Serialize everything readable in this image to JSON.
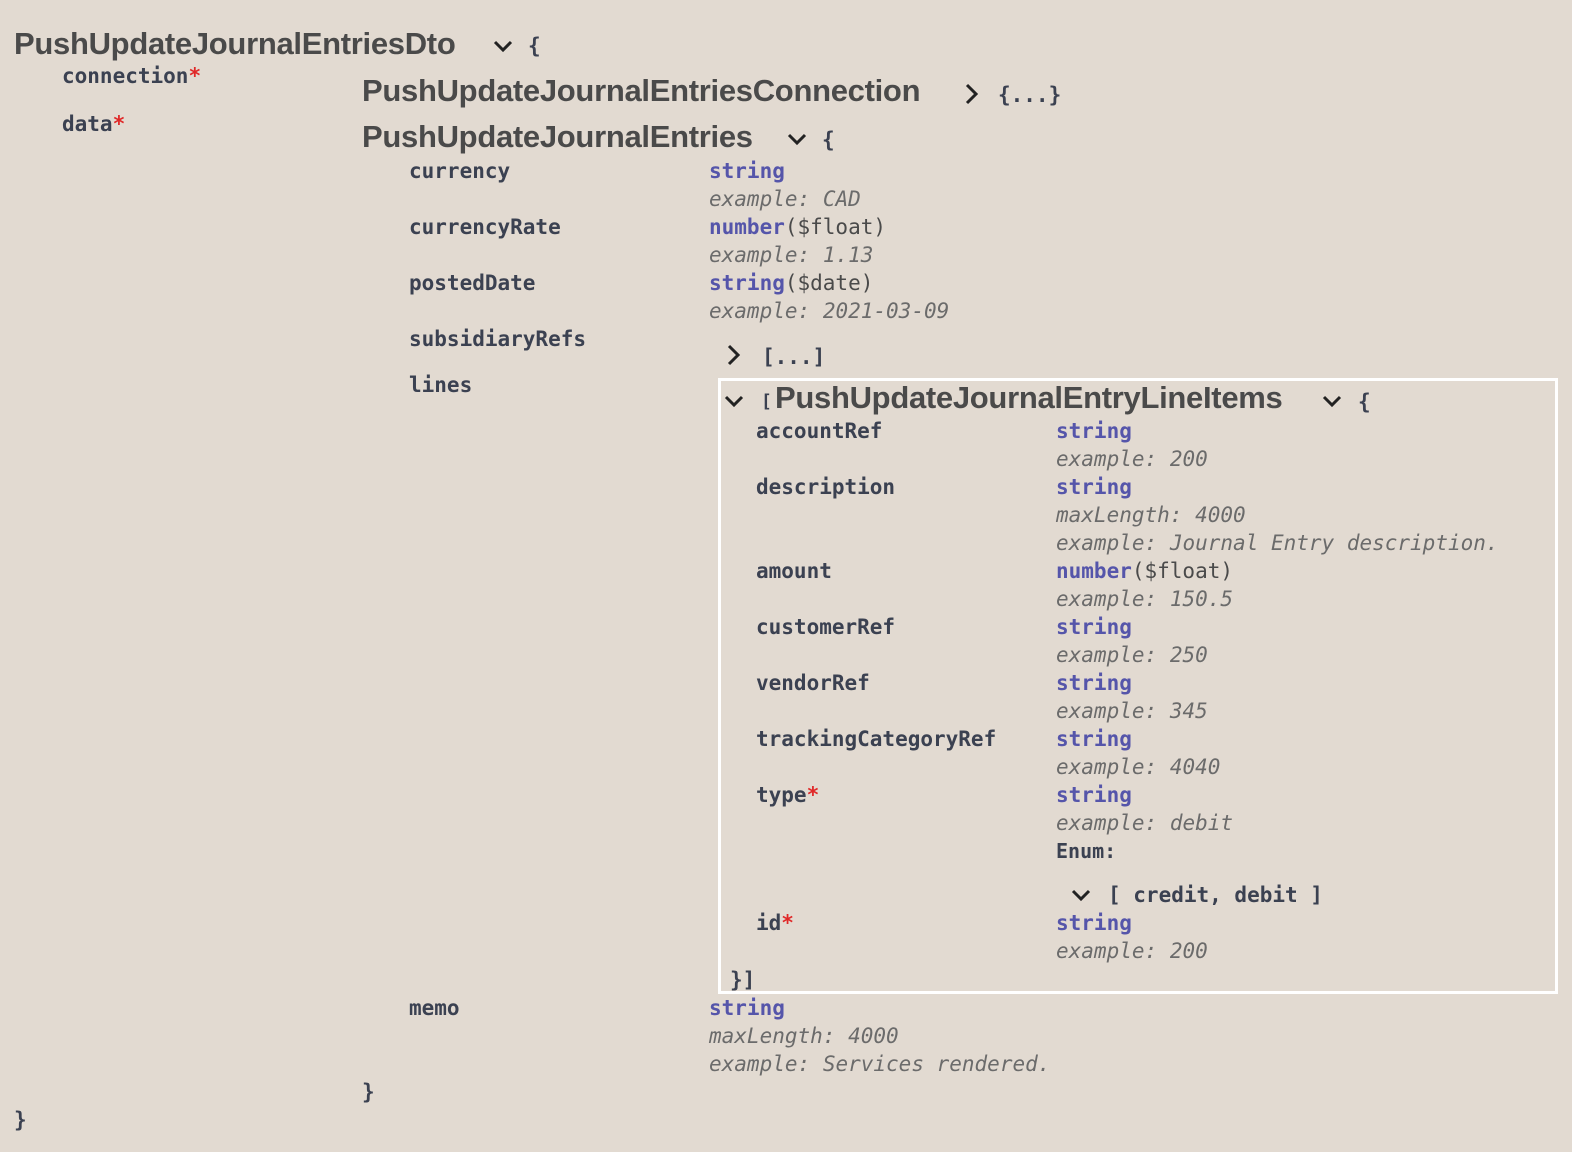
{
  "root": {
    "title": "PushUpdateJournalEntriesDto",
    "open_brace": "{",
    "close_brace": "}"
  },
  "connection": {
    "name": "connection",
    "required_mark": "*",
    "model": "PushUpdateJournalEntriesConnection",
    "collapsed": "{...}"
  },
  "data": {
    "name": "data",
    "required_mark": "*",
    "model": "PushUpdateJournalEntries",
    "open_brace": "{",
    "close_brace": "}",
    "props": {
      "currency": {
        "name": "currency",
        "type": "string",
        "example_label": "example:",
        "example_value": "CAD"
      },
      "currencyRate": {
        "name": "currencyRate",
        "type": "number",
        "format": "($float)",
        "example_label": "example:",
        "example_value": "1.13"
      },
      "postedDate": {
        "name": "postedDate",
        "type": "string",
        "format": "($date)",
        "example_label": "example:",
        "example_value": "2021-03-09"
      },
      "subsidiaryRefs": {
        "name": "subsidiaryRefs",
        "collapsed": "[...]"
      },
      "lines": {
        "name": "lines"
      },
      "memo": {
        "name": "memo",
        "type": "string",
        "maxlength_label": "maxLength:",
        "maxlength_value": "4000",
        "example_label": "example:",
        "example_value": "Services rendered."
      }
    }
  },
  "lines_item": {
    "open_bracket": "[",
    "model": "PushUpdateJournalEntryLineItems",
    "open_brace": "{",
    "close": "}]",
    "props": {
      "accountRef": {
        "name": "accountRef",
        "type": "string",
        "example_label": "example:",
        "example_value": "200"
      },
      "description": {
        "name": "description",
        "type": "string",
        "maxlength_label": "maxLength:",
        "maxlength_value": "4000",
        "example_label": "example:",
        "example_value": "Journal Entry description."
      },
      "amount": {
        "name": "amount",
        "type": "number",
        "format": "($float)",
        "example_label": "example:",
        "example_value": "150.5"
      },
      "customerRef": {
        "name": "customerRef",
        "type": "string",
        "example_label": "example:",
        "example_value": "250"
      },
      "vendorRef": {
        "name": "vendorRef",
        "type": "string",
        "example_label": "example:",
        "example_value": "345"
      },
      "trackingCategoryRef": {
        "name": "trackingCategoryRef",
        "type": "string",
        "example_label": "example:",
        "example_value": "4040"
      },
      "type": {
        "name": "type",
        "required_mark": "*",
        "type": "string",
        "example_label": "example:",
        "example_value": "debit",
        "enum_label": "Enum:",
        "enum_values": "[ credit, debit ]"
      },
      "id": {
        "name": "id",
        "required_mark": "*",
        "type": "string",
        "example_label": "example:",
        "example_value": "200"
      }
    }
  },
  "icons": {
    "expanded": "chevron-down-icon",
    "collapsed": "chevron-right-icon"
  },
  "colors": {
    "background": "#e2dad1",
    "type": "#55aa",
    "required": "#e02828",
    "highlight_border": "#ffffff"
  }
}
